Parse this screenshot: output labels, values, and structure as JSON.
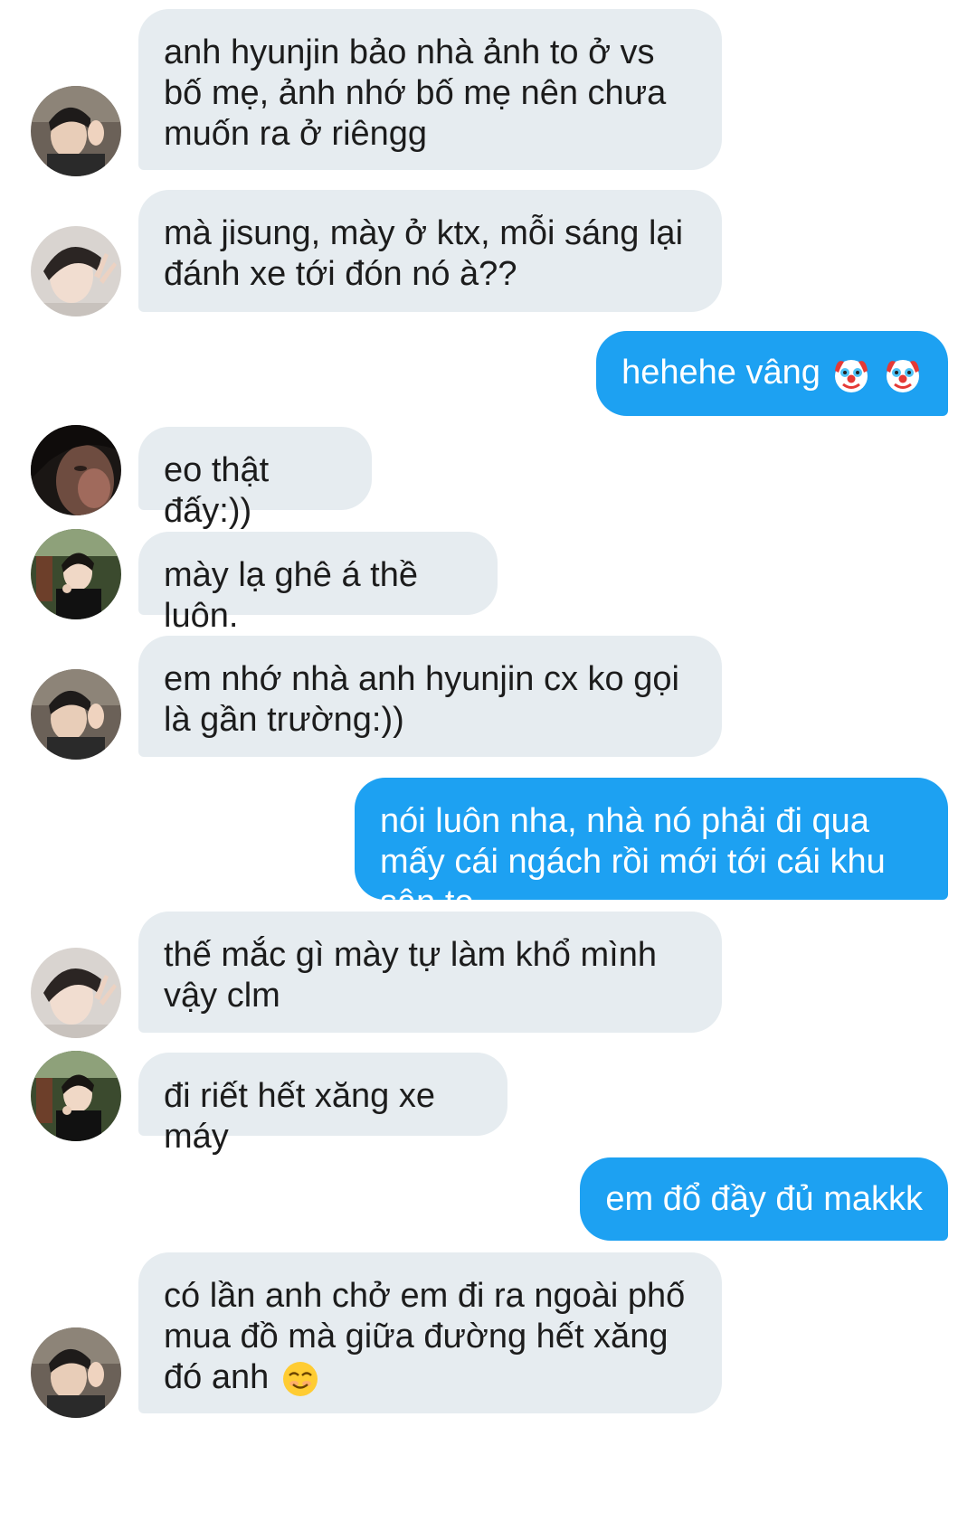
{
  "conversation": {
    "messages": [
      {
        "sender": "other",
        "avatar": "avatar-peace-sign",
        "text": "anh hyunjin bảo nhà ảnh to ở vs bố mẹ, ảnh nhớ bố mẹ nên chưa muốn ra ở riêngg"
      },
      {
        "sender": "other",
        "avatar": "avatar-v-sign",
        "text": "mà jisung, mày ở ktx, mỗi sáng lại đánh xe tới đón nó à??"
      },
      {
        "sender": "me",
        "text": "hehehe vâng",
        "emoji": [
          "clown-face-icon",
          "clown-face-icon"
        ]
      },
      {
        "sender": "other",
        "avatar": "avatar-dark-closeup",
        "text": "eo thật đấy:))"
      },
      {
        "sender": "other",
        "avatar": "avatar-bus-window",
        "text": "mày lạ ghê á thề luôn."
      },
      {
        "sender": "other",
        "avatar": "avatar-peace-sign",
        "text": "em nhớ nhà anh hyunjin cx ko gọi là gần trường:))"
      },
      {
        "sender": "me",
        "text": "nói luôn nha, nhà nó phải đi qua mấy cái ngách rồi mới tới cái khu sân to"
      },
      {
        "sender": "other",
        "avatar": "avatar-v-sign",
        "text": "thế mắc gì mày tự làm khổ mình vậy clm"
      },
      {
        "sender": "other",
        "avatar": "avatar-bus-window",
        "text": "đi riết hết xăng xe máy"
      },
      {
        "sender": "me",
        "text": "em đổ đầy đủ makkk"
      },
      {
        "sender": "other",
        "avatar": "avatar-peace-sign",
        "text": "có lần anh chở em đi ra ngoài phố mua đồ mà giữa đường hết xăng đó anh",
        "emoji": [
          "smiling-face-icon"
        ]
      }
    ]
  },
  "colors": {
    "incoming_bubble": "#e6ecf0",
    "outgoing_bubble": "#1da1f2",
    "incoming_text": "#1c1c1c",
    "outgoing_text": "#ffffff"
  }
}
